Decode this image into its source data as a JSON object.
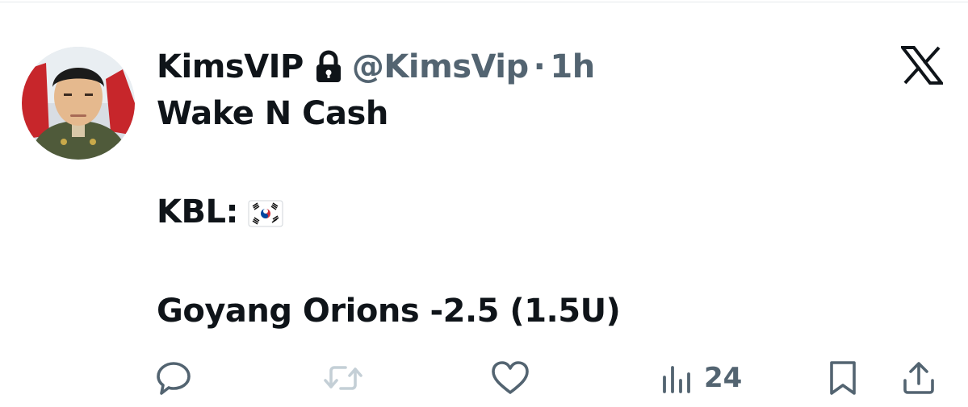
{
  "tweet": {
    "display_name": "KimsVIP",
    "handle": "@KimsVip",
    "separator": "·",
    "time": "1h",
    "text_line1": "Wake N Cash",
    "text_line2": "KBL:",
    "text_line3": "Goyang Orions -2.5 (1.5U)"
  },
  "actions": {
    "views_count": "24"
  },
  "colors": {
    "text": "#0f1419",
    "secondary": "#536471",
    "retweet_disabled": "#c4cfd6"
  },
  "icons": [
    "lock-icon",
    "x-logo-icon",
    "south-korea-flag-icon",
    "reply-icon",
    "retweet-icon",
    "like-icon",
    "views-icon",
    "bookmark-icon",
    "share-icon"
  ]
}
